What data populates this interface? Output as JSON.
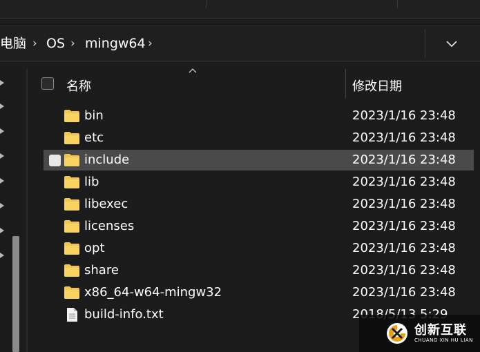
{
  "breadcrumb": {
    "items": [
      "电脑",
      "OS",
      "mingw64"
    ],
    "separator": "›"
  },
  "header": {
    "name_label": "名称",
    "date_label": "修改日期"
  },
  "files": [
    {
      "name": "bin",
      "date": "2023/1/16 23:48",
      "type": "folder",
      "selected": false
    },
    {
      "name": "etc",
      "date": "2023/1/16 23:48",
      "type": "folder",
      "selected": false
    },
    {
      "name": "include",
      "date": "2023/1/16 23:48",
      "type": "folder",
      "selected": true
    },
    {
      "name": "lib",
      "date": "2023/1/16 23:48",
      "type": "folder",
      "selected": false
    },
    {
      "name": "libexec",
      "date": "2023/1/16 23:48",
      "type": "folder",
      "selected": false
    },
    {
      "name": "licenses",
      "date": "2023/1/16 23:48",
      "type": "folder",
      "selected": false
    },
    {
      "name": "opt",
      "date": "2023/1/16 23:48",
      "type": "folder",
      "selected": false
    },
    {
      "name": "share",
      "date": "2023/1/16 23:48",
      "type": "folder",
      "selected": false
    },
    {
      "name": "x86_64-w64-mingw32",
      "date": "2023/1/16 23:48",
      "type": "folder",
      "selected": false
    },
    {
      "name": "build-info.txt",
      "date": "2018/5/13 5:29",
      "type": "text-file",
      "selected": false
    }
  ],
  "watermark": {
    "title": "创新互联",
    "subtitle": "CHUANG XIN HU LIAN"
  },
  "colors": {
    "background": "#1c1c1c",
    "selected_row": "#4a4a4a",
    "folder": "#f4c44a",
    "watermark_accent": "#e8a21a"
  }
}
